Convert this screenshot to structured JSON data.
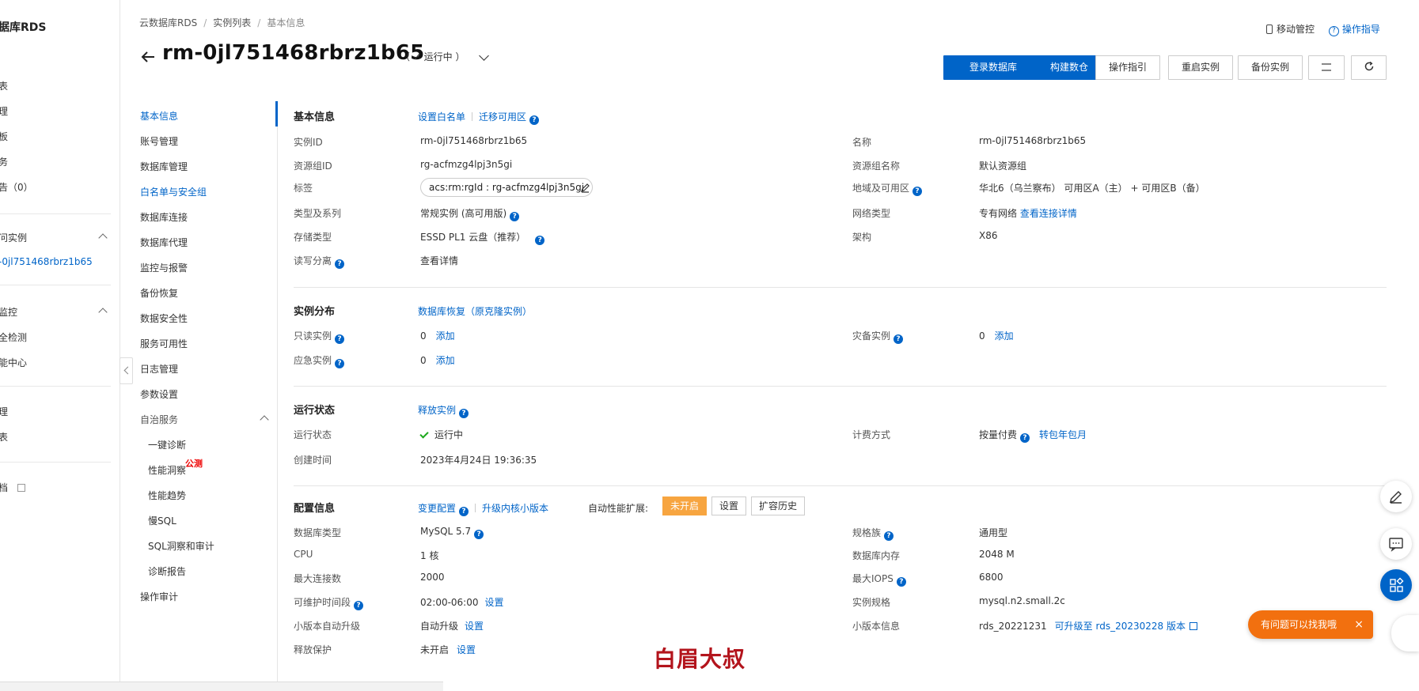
{
  "leftnav": {
    "title": "据库RDS",
    "items": [
      {
        "label": "表"
      },
      {
        "label": "理"
      },
      {
        "label": "板"
      },
      {
        "label": "务"
      },
      {
        "label": "告（0）"
      },
      {
        "label": "问实例"
      },
      {
        "label": "-0jl751468rbrz1b65"
      },
      {
        "label": "监控"
      },
      {
        "label": "全检测"
      },
      {
        "label": "能中心"
      },
      {
        "label": "理"
      },
      {
        "label": "表"
      },
      {
        "label": "档"
      }
    ]
  },
  "breadcrumb": {
    "root": "云数据库RDS",
    "list": "实例列表",
    "current": "基本信息",
    "sep": "/"
  },
  "header": {
    "title": "rm-0jl751468rbrz1b65",
    "status": "（ ✓ 运行中 ）",
    "mobile": "移动管控",
    "guide": "操作指导"
  },
  "toolbar": {
    "login": "登录数据库",
    "build": "构建数仓",
    "ops": "操作指引",
    "restart": "重启实例",
    "backup": "备份实例"
  },
  "subnav": {
    "items": [
      "基本信息",
      "账号管理",
      "数据库管理",
      "白名单与安全组",
      "数据库连接",
      "数据库代理",
      "监控与报警",
      "备份恢复",
      "数据安全性",
      "服务可用性",
      "日志管理",
      "参数设置",
      "自治服务"
    ],
    "sub": [
      "一键诊断",
      "性能洞察",
      "性能趋势",
      "慢SQL",
      "SQL洞察和审计",
      "诊断报告"
    ],
    "badge": "公测",
    "last": "操作审计"
  },
  "basic": {
    "title": "基本信息",
    "links": [
      "设置白名单",
      "迁移可用区"
    ],
    "rows": {
      "instance_id_label": "实例ID",
      "instance_id": "rm-0jl751468rbrz1b65",
      "name_label": "名称",
      "name": "rm-0jl751468rbrz1b65",
      "rg_id_label": "资源组ID",
      "rg_id": "rg-acfmzg4lpj3n5gi",
      "rg_name_label": "资源组名称",
      "rg_name": "默认资源组",
      "tag_label": "标签",
      "tag": "acs:rm:rgId : rg-acfmzg4lpj3n5gi",
      "region_label": "地域及可用区",
      "region": "华北6（乌兰察布） 可用区A（主） + 可用区B（备）",
      "type_label": "类型及系列",
      "type": "常规实例 (高可用版)",
      "net_label": "网络类型",
      "net": "专有网络",
      "net_link": "查看连接详情",
      "storage_label": "存储类型",
      "storage": "ESSD PL1 云盘（推荐）",
      "arch_label": "架构",
      "arch": "X86",
      "rw_label": "读写分离",
      "rw_link": "查看详情"
    }
  },
  "distribution": {
    "title": "实例分布",
    "link": "数据库恢复（原克隆实例）",
    "ro_label": "只读实例",
    "ro_count": "0",
    "ro_add": "添加",
    "dr_label": "灾备实例",
    "dr_count": "0",
    "dr_add": "添加",
    "em_label": "应急实例",
    "em_count": "0",
    "em_add": "添加"
  },
  "runstate": {
    "title": "运行状态",
    "link": "释放实例",
    "state_label": "运行状态",
    "state": "运行中",
    "billing_label": "计费方式",
    "billing": "按量付费",
    "billing_link": "转包年包月",
    "created_label": "创建时间",
    "created": "2023年4月24日 19:36:35"
  },
  "config": {
    "title": "配置信息",
    "link1": "变更配置",
    "link2": "升级内核小版本",
    "auto_label": "自动性能扩展:",
    "auto_state": "未开启",
    "auto_set": "设置",
    "auto_history": "扩容历史",
    "dbtype_label": "数据库类型",
    "dbtype": "MySQL  5.7",
    "family_label": "规格族",
    "family": "通用型",
    "cpu_label": "CPU",
    "cpu": "1 核",
    "mem_label": "数据库内存",
    "mem": "2048 M",
    "conn_label": "最大连接数",
    "conn": "2000",
    "iops_label": "最大IOPS",
    "iops": "6800",
    "maint_label": "可维护时间段",
    "maint": "02:00-06:00",
    "maint_set": "设置",
    "spec_label": "实例规格",
    "spec": "mysql.n2.small.2c",
    "minor_label": "小版本自动升级",
    "minor": "自动升级",
    "minor_set": "设置",
    "minorinfo_label": "小版本信息",
    "minorinfo": "rds_20221231",
    "minorinfo_link": "可升级至 rds_20230228 版本",
    "release_label": "释放保护",
    "release": "未开启",
    "release_set": "设置"
  },
  "float": {
    "help": "有问题可以找我哦",
    "close": "×"
  },
  "watermark": "白眉大叔"
}
